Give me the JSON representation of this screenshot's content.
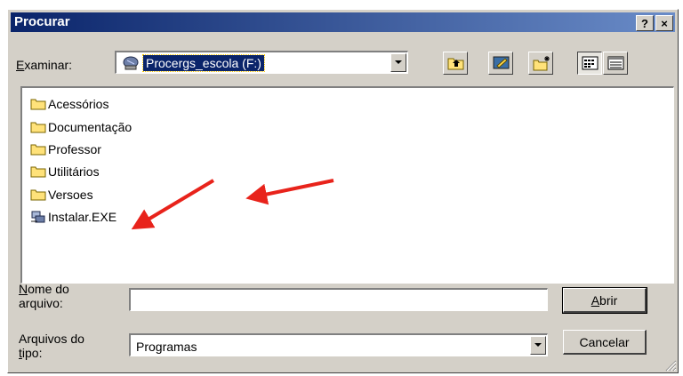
{
  "window": {
    "title": "Procurar",
    "help_label": "?",
    "close_label": "×"
  },
  "toolbar": {
    "look_in_label_underlined": "E",
    "look_in_label_rest": "xaminar:",
    "look_in_value": "Procergs_escola (F:)",
    "look_in_icon": "network-drive-icon",
    "buttons": [
      "up-one-level-icon",
      "desktop-icon",
      "new-folder-icon",
      "list-view-icon",
      "details-view-icon"
    ]
  },
  "files": [
    {
      "name": "Acessórios",
      "icon": "folder-icon"
    },
    {
      "name": "Documentação",
      "icon": "folder-icon"
    },
    {
      "name": "Professor",
      "icon": "folder-icon"
    },
    {
      "name": "Utilitários",
      "icon": "folder-icon"
    },
    {
      "name": "Versoes",
      "icon": "folder-icon"
    },
    {
      "name": "Instalar.EXE",
      "icon": "setup-exe-icon"
    }
  ],
  "filename": {
    "label_line1_underlined": "N",
    "label_line1_rest": "ome do",
    "label_line2": "arquivo:",
    "value": ""
  },
  "filetype": {
    "label_line1": "Arquivos do",
    "label_line2_underlined": "t",
    "label_line2_rest": "ipo:",
    "value": "Programas"
  },
  "buttons": {
    "open_underlined": "A",
    "open_rest": "brir",
    "cancel": "Cancelar"
  },
  "colors": {
    "title_start": "#0a246a",
    "title_end": "#6a8cc8",
    "face": "#d4d0c8",
    "selection": "#0a246a",
    "annotation_arrow": "#e8231b",
    "folder": "#ffe27a"
  }
}
